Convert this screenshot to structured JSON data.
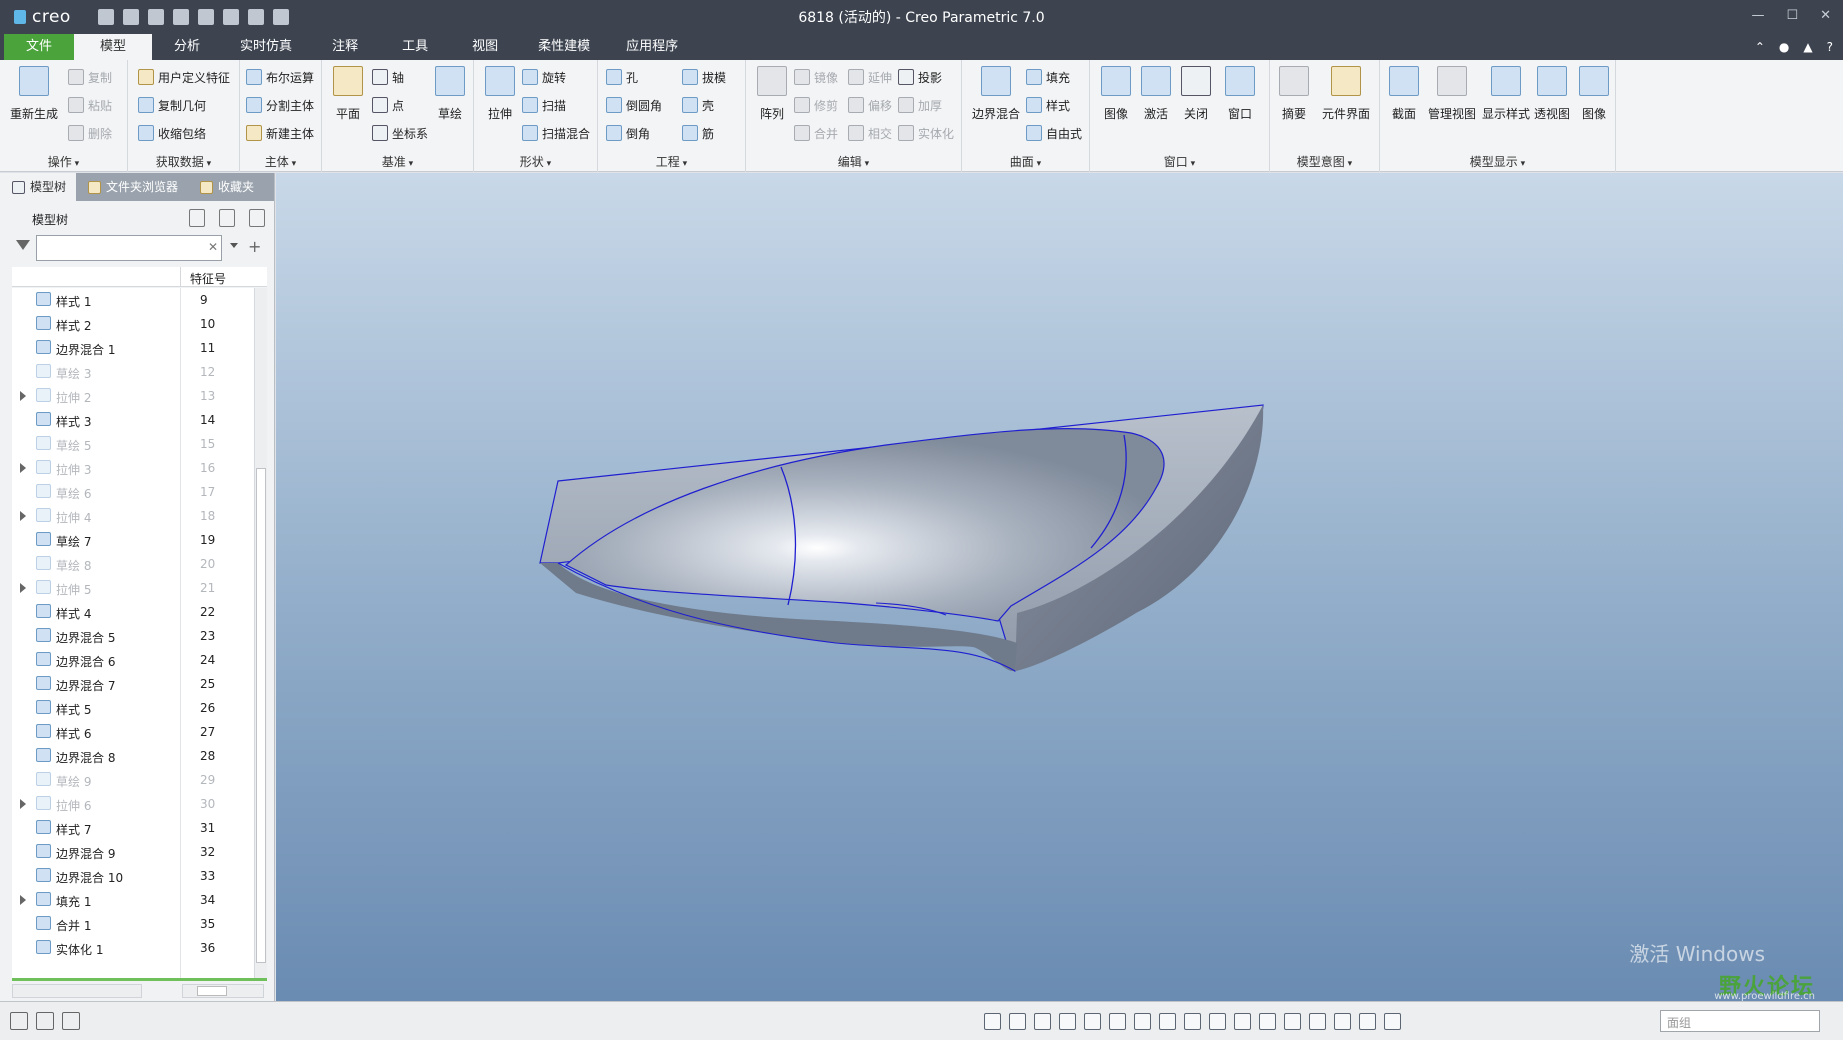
{
  "app": {
    "logo_text": "creo",
    "window_title": "6818 (活动的) - Creo Parametric 7.0"
  },
  "ribbon_tabs": [
    {
      "label": "文件"
    },
    {
      "label": "模型"
    },
    {
      "label": "分析"
    },
    {
      "label": "实时仿真"
    },
    {
      "label": "注释"
    },
    {
      "label": "工具"
    },
    {
      "label": "视图"
    },
    {
      "label": "柔性建模"
    },
    {
      "label": "应用程序"
    }
  ],
  "ribbon": {
    "operations": {
      "label": "操作",
      "regenerate": "重新生成",
      "copy": "复制",
      "paste": "粘贴",
      "delete": "删除"
    },
    "get_data": {
      "label": "获取数据",
      "udf": "用户定义特征",
      "copy_geometry": "复制几何",
      "shrinkwrap": "收缩包络"
    },
    "body": {
      "label": "主体",
      "boolean": "布尔运算",
      "split": "分割主体",
      "new_body": "新建主体"
    },
    "datum": {
      "label": "基准",
      "plane": "平面",
      "axis": "轴",
      "point": "点",
      "coord": "坐标系",
      "sketch": "草绘"
    },
    "shape": {
      "label": "形状",
      "extrude": "拉伸",
      "revolve": "旋转",
      "sweep": "扫描",
      "swept_blend": "扫描混合"
    },
    "engineering": {
      "label": "工程",
      "hole": "孔",
      "draft": "拔模",
      "round": "倒圆角",
      "shell": "壳",
      "chamfer": "倒角",
      "rib": "筋"
    },
    "editing": {
      "label": "编辑",
      "pattern": "阵列",
      "mirror": "镜像",
      "extend": "延伸",
      "project": "投影",
      "trim": "修剪",
      "offset": "偏移",
      "thicken": "加厚",
      "merge": "合并",
      "intersect": "相交",
      "solidify": "实体化"
    },
    "surfaces": {
      "label": "曲面",
      "boundary_blend": "边界混合",
      "fill": "填充",
      "style": "样式",
      "freestyle": "自由式"
    },
    "window": {
      "label": "窗口",
      "image": "图像",
      "activate": "激活",
      "close": "关闭",
      "windows": "窗口"
    },
    "model_intent": {
      "label": "模型意图",
      "summary": "摘要",
      "component_interface": "元件界面"
    },
    "model_display": {
      "label": "模型显示",
      "section": "截面",
      "manage_views": "管理视图",
      "display_style": "显示样式",
      "perspective": "透视图",
      "image": "图像"
    }
  },
  "panel": {
    "tabs": [
      {
        "label": "模型树"
      },
      {
        "label": "文件夹浏览器"
      },
      {
        "label": "收藏夹"
      }
    ],
    "title": "模型树",
    "filter_placeholder": "",
    "col_feature_id": "特征号",
    "rows": [
      {
        "name": "样式 1",
        "id": "9",
        "dim": false,
        "expand": false,
        "icon": "style-icon"
      },
      {
        "name": "样式 2",
        "id": "10",
        "dim": false,
        "expand": false,
        "icon": "style-icon"
      },
      {
        "name": "边界混合 1",
        "id": "11",
        "dim": false,
        "expand": false,
        "icon": "boundary-blend-icon"
      },
      {
        "name": "草绘 3",
        "id": "12",
        "dim": true,
        "expand": false,
        "icon": "sketch-icon"
      },
      {
        "name": "拉伸 2",
        "id": "13",
        "dim": true,
        "expand": true,
        "icon": "extrude-icon"
      },
      {
        "name": "样式 3",
        "id": "14",
        "dim": false,
        "expand": false,
        "icon": "style-icon"
      },
      {
        "name": "草绘 5",
        "id": "15",
        "dim": true,
        "expand": false,
        "icon": "sketch-icon"
      },
      {
        "name": "拉伸 3",
        "id": "16",
        "dim": true,
        "expand": true,
        "icon": "extrude-icon"
      },
      {
        "name": "草绘 6",
        "id": "17",
        "dim": true,
        "expand": false,
        "icon": "sketch-icon"
      },
      {
        "name": "拉伸 4",
        "id": "18",
        "dim": true,
        "expand": true,
        "icon": "extrude-icon"
      },
      {
        "name": "草绘 7",
        "id": "19",
        "dim": false,
        "expand": false,
        "icon": "sketch-icon"
      },
      {
        "name": "草绘 8",
        "id": "20",
        "dim": true,
        "expand": false,
        "icon": "sketch-icon"
      },
      {
        "name": "拉伸 5",
        "id": "21",
        "dim": true,
        "expand": true,
        "icon": "extrude-icon"
      },
      {
        "name": "样式 4",
        "id": "22",
        "dim": false,
        "expand": false,
        "icon": "style-icon"
      },
      {
        "name": "边界混合 5",
        "id": "23",
        "dim": false,
        "expand": false,
        "icon": "boundary-blend-icon"
      },
      {
        "name": "边界混合 6",
        "id": "24",
        "dim": false,
        "expand": false,
        "icon": "boundary-blend-icon"
      },
      {
        "name": "边界混合 7",
        "id": "25",
        "dim": false,
        "expand": false,
        "icon": "boundary-blend-icon"
      },
      {
        "name": "样式 5",
        "id": "26",
        "dim": false,
        "expand": false,
        "icon": "style-icon"
      },
      {
        "name": "样式 6",
        "id": "27",
        "dim": false,
        "expand": false,
        "icon": "style-icon"
      },
      {
        "name": "边界混合 8",
        "id": "28",
        "dim": false,
        "expand": false,
        "icon": "boundary-blend-icon"
      },
      {
        "name": "草绘 9",
        "id": "29",
        "dim": true,
        "expand": false,
        "icon": "sketch-icon"
      },
      {
        "name": "拉伸 6",
        "id": "30",
        "dim": true,
        "expand": true,
        "icon": "extrude-icon"
      },
      {
        "name": "样式 7",
        "id": "31",
        "dim": false,
        "expand": false,
        "icon": "style-icon"
      },
      {
        "name": "边界混合 9",
        "id": "32",
        "dim": false,
        "expand": false,
        "icon": "boundary-blend-icon"
      },
      {
        "name": "边界混合 10",
        "id": "33",
        "dim": false,
        "expand": false,
        "icon": "boundary-blend-icon"
      },
      {
        "name": "填充 1",
        "id": "34",
        "dim": false,
        "expand": true,
        "icon": "fill-icon"
      },
      {
        "name": "合并 1",
        "id": "35",
        "dim": false,
        "expand": false,
        "icon": "merge-icon"
      },
      {
        "name": "实体化 1",
        "id": "36",
        "dim": false,
        "expand": false,
        "icon": "solidify-icon"
      }
    ]
  },
  "viewport": {
    "watermark": "激活 Windows",
    "forum_name": "野火论坛",
    "forum_url": "www.proewildfire.cn"
  },
  "status": {
    "selection_filter": "面组"
  },
  "colors": {
    "titlebar": "#3d4450",
    "file_tab": "#4aa33b",
    "model_edge": "#1f1fd0"
  }
}
